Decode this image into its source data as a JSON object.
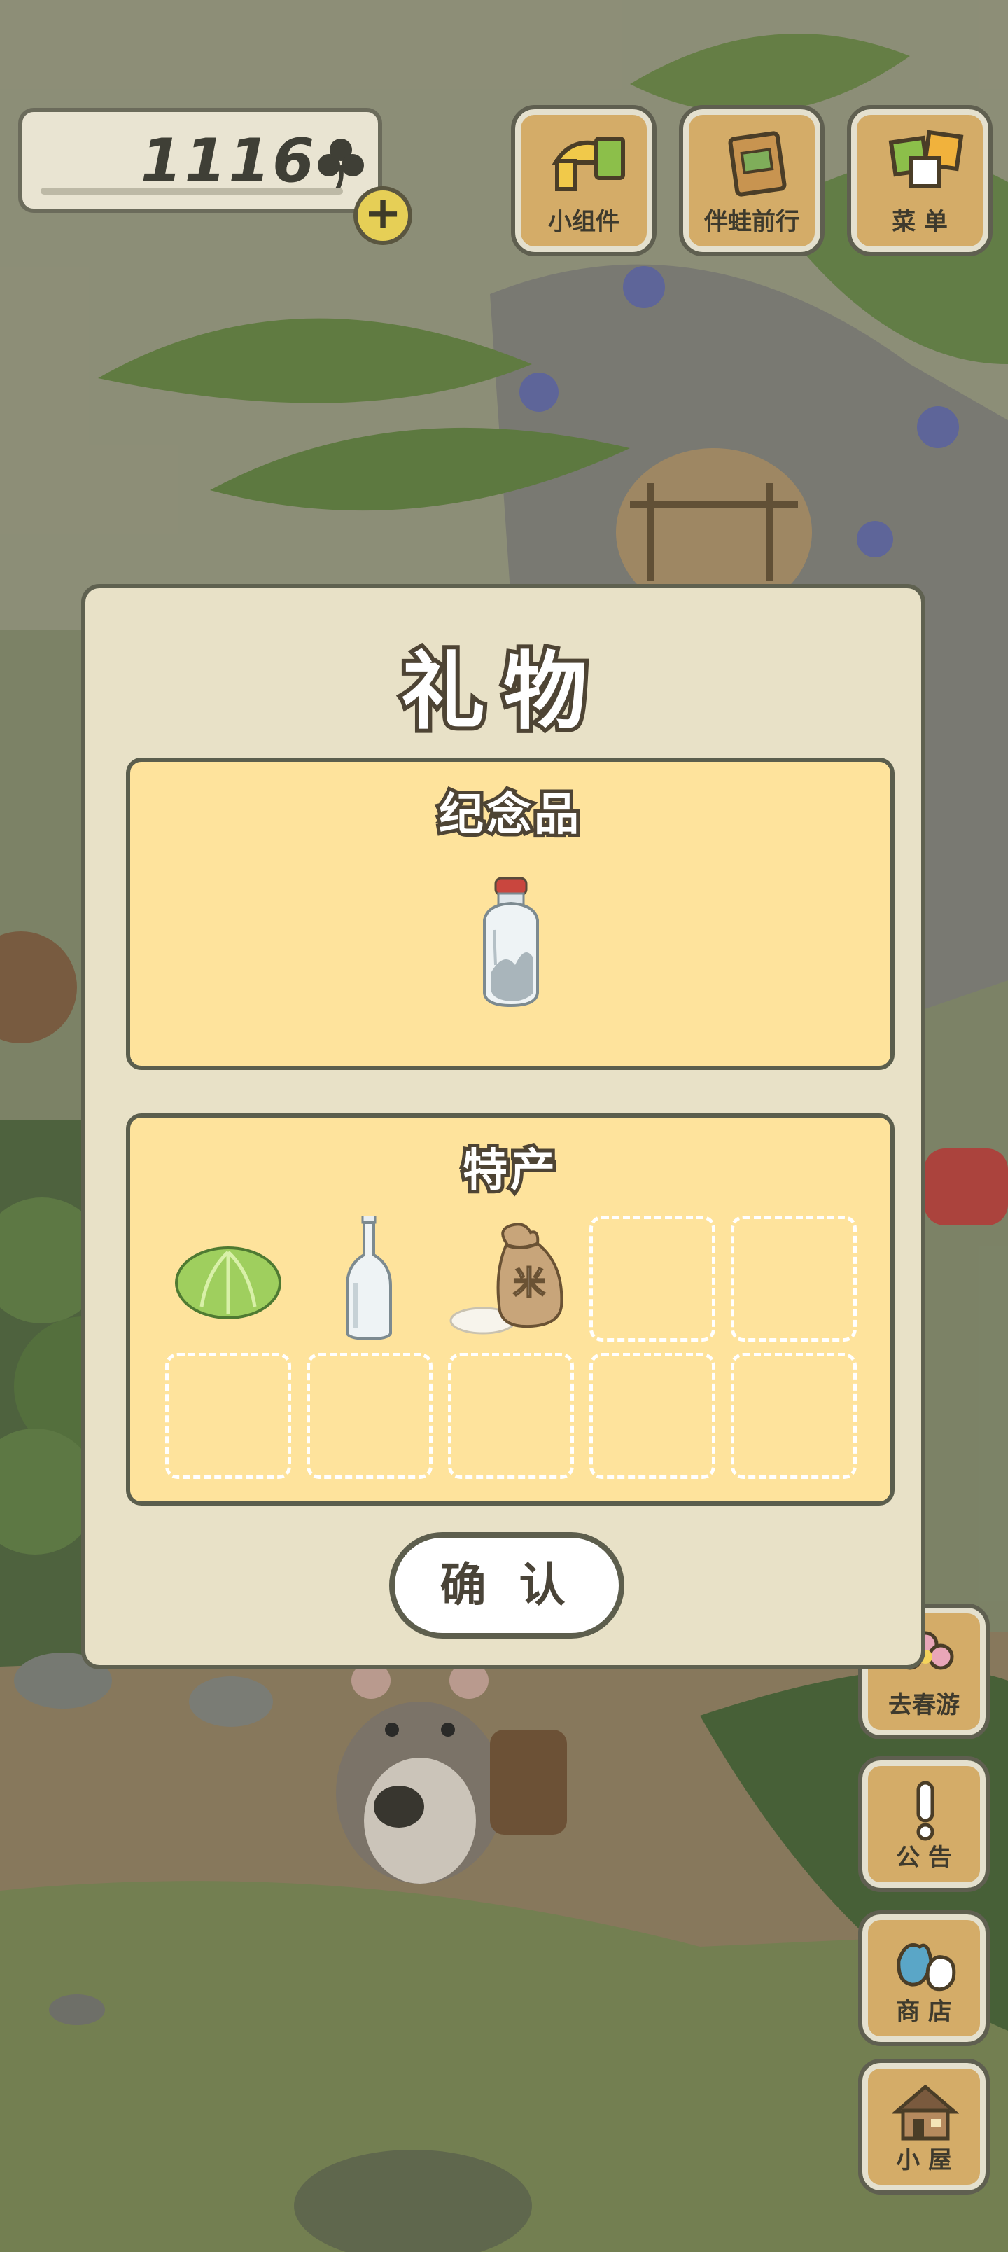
{
  "hud": {
    "clover_count": "1116",
    "plus_label": "+"
  },
  "top_buttons": {
    "widgets": "小组件",
    "frog_travel": "伴蛙前行",
    "menu": "菜 单"
  },
  "side_buttons": {
    "spring_trip": "去春游",
    "notice": "公 告",
    "shop": "商 店",
    "house": "小 屋"
  },
  "gift_dialog": {
    "title": "礼物",
    "souvenir": {
      "title": "纪念品",
      "items": [
        "snuff-bottle"
      ]
    },
    "specialty": {
      "title": "特产",
      "items": [
        "cabbage",
        "glass-bottle",
        "rice-bag",
        "",
        "",
        "",
        "",
        "",
        "",
        ""
      ]
    },
    "confirm_label": "确 认"
  },
  "rice_bag_mark": "米",
  "colors": {
    "panel_fill": "#fee39c",
    "dialog_fill": "#e8e1c7",
    "outline": "#5b5e4d",
    "button_wood": "#d4ac68"
  }
}
